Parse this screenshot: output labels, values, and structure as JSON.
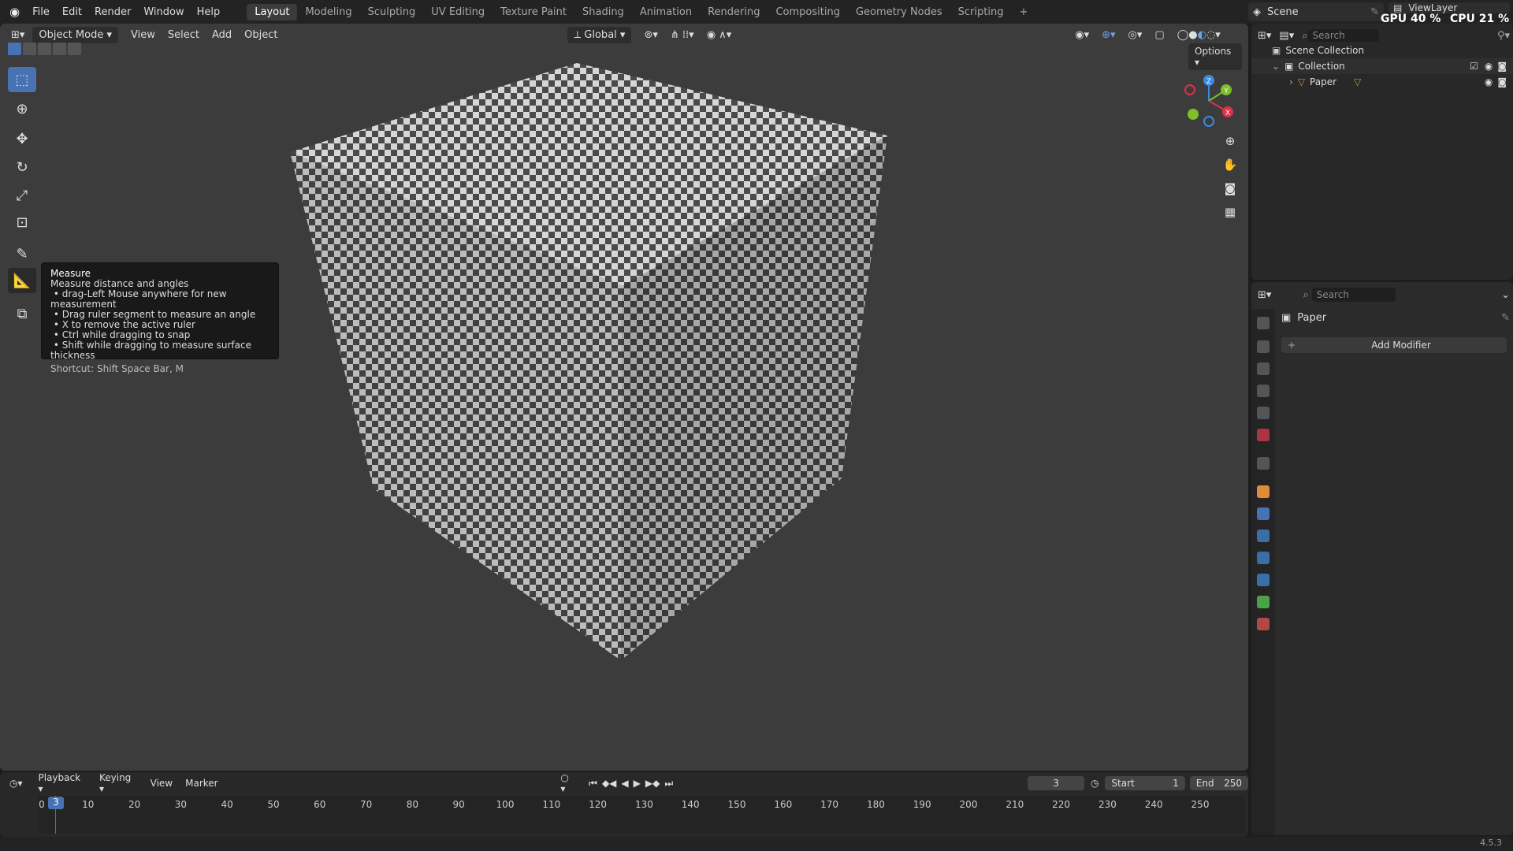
{
  "topbar": {
    "menus": [
      "File",
      "Edit",
      "Render",
      "Window",
      "Help"
    ],
    "workspaces": [
      "Layout",
      "Modeling",
      "Sculpting",
      "UV Editing",
      "Texture Paint",
      "Shading",
      "Animation",
      "Rendering",
      "Compositing",
      "Geometry Nodes",
      "Scripting"
    ],
    "active_workspace": "Layout",
    "add_tab": "+",
    "scene": "Scene",
    "view_layer": "ViewLayer",
    "gpu": "GPU 40 %",
    "cpu": "CPU 21 %"
  },
  "viewport_header": {
    "mode": "Object Mode",
    "menus": [
      "View",
      "Select",
      "Add",
      "Object"
    ],
    "orientation": "Global",
    "options": "Options"
  },
  "tools": [
    "select-box",
    "cursor",
    "move",
    "rotate",
    "scale",
    "transform",
    "annotate",
    "measure",
    "add-cube"
  ],
  "tooltip": {
    "title": "Measure",
    "description": "Measure distance and angles",
    "bullets": [
      "drag-Left Mouse anywhere for new measurement",
      "Drag ruler segment to measure an angle",
      "X to remove the active ruler",
      "Ctrl while dragging to snap",
      "Shift while dragging to measure surface thickness"
    ],
    "shortcut": "Shortcut: Shift Space Bar, M"
  },
  "gizmo": {
    "x": "X",
    "y": "Y",
    "z": "Z"
  },
  "outliner": {
    "search_placeholder": "Search",
    "scene_collection": "Scene Collection",
    "collection": "Collection",
    "object": "Paper"
  },
  "properties": {
    "search_placeholder": "Search",
    "object_name": "Paper",
    "add_modifier": "Add Modifier",
    "add_icon": "+"
  },
  "timeline": {
    "menus": [
      "Playback",
      "Keying",
      "View",
      "Marker"
    ],
    "current_frame": "3",
    "start_label": "Start",
    "start": "1",
    "end_label": "End",
    "end": "250",
    "ticks": [
      "0",
      "10",
      "20",
      "30",
      "40",
      "50",
      "60",
      "70",
      "80",
      "90",
      "100",
      "110",
      "120",
      "130",
      "140",
      "150",
      "160",
      "170",
      "180",
      "190",
      "200",
      "210",
      "220",
      "230",
      "240",
      "250"
    ]
  },
  "status": {
    "version": "4.5.3"
  },
  "colors": {
    "accent": "#4772b3",
    "x_axis": "#e0304a",
    "y_axis": "#7fbf2a",
    "z_axis": "#3a8be0"
  }
}
